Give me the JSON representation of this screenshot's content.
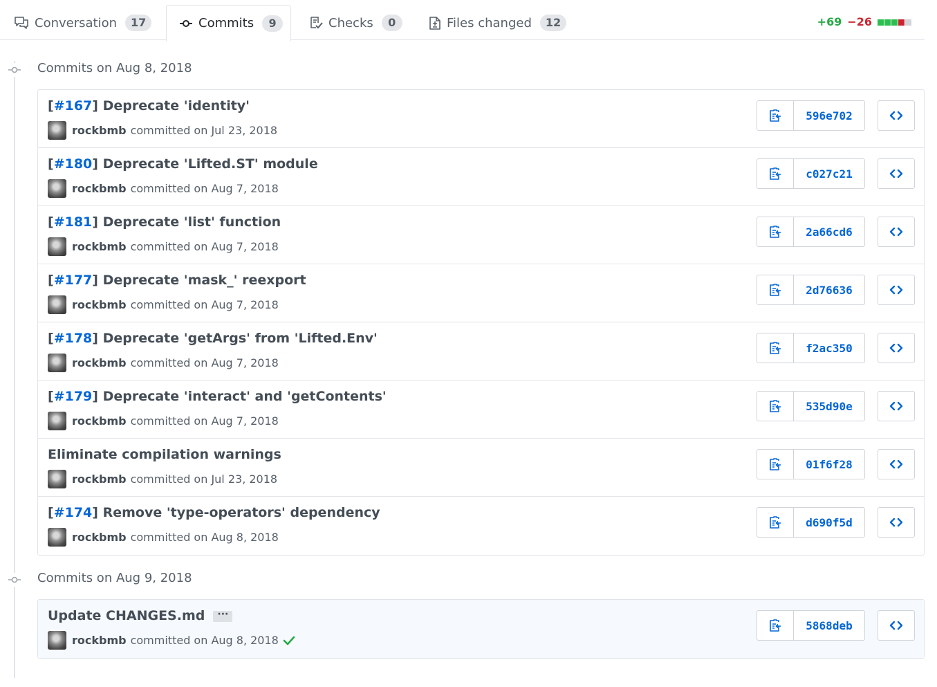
{
  "tabs": {
    "conversation": {
      "label": "Conversation",
      "count": "17",
      "icon": "comment-discussion-icon"
    },
    "commits": {
      "label": "Commits",
      "count": "9",
      "icon": "git-commit-icon"
    },
    "checks": {
      "label": "Checks",
      "count": "0",
      "icon": "checklist-icon"
    },
    "files": {
      "label": "Files changed",
      "count": "12",
      "icon": "file-diff-icon"
    }
  },
  "diffstat": {
    "additions": "+69",
    "deletions": "−26",
    "blocks": [
      "added",
      "added",
      "added",
      "removed",
      "neutral"
    ],
    "colors": {
      "added": "#2cbe4e",
      "removed": "#cb2431",
      "neutral": "#d1d5da"
    }
  },
  "groups": [
    {
      "title": "Commits on Aug 8, 2018",
      "commits": [
        {
          "issue_prefix": "[",
          "issue": "#167",
          "issue_suffix": "]",
          "message": " Deprecate 'identity'",
          "author": "rockbmb",
          "date_text": "committed on Jul 23, 2018",
          "sha": "596e702"
        },
        {
          "issue_prefix": "[",
          "issue": "#180",
          "issue_suffix": "]",
          "message": " Deprecate 'Lifted.ST' module",
          "author": "rockbmb",
          "date_text": "committed on Aug 7, 2018",
          "sha": "c027c21"
        },
        {
          "issue_prefix": "[",
          "issue": "#181",
          "issue_suffix": "]",
          "message": " Deprecate 'list' function",
          "author": "rockbmb",
          "date_text": "committed on Aug 7, 2018",
          "sha": "2a66cd6"
        },
        {
          "issue_prefix": "[",
          "issue": "#177",
          "issue_suffix": "]",
          "message": " Deprecate 'mask_' reexport",
          "author": "rockbmb",
          "date_text": "committed on Aug 7, 2018",
          "sha": "2d76636"
        },
        {
          "issue_prefix": "[",
          "issue": "#178",
          "issue_suffix": "]",
          "message": " Deprecate 'getArgs' from 'Lifted.Env'",
          "author": "rockbmb",
          "date_text": "committed on Aug 7, 2018",
          "sha": "f2ac350"
        },
        {
          "issue_prefix": "[",
          "issue": "#179",
          "issue_suffix": "]",
          "message": " Deprecate 'interact' and 'getContents'",
          "author": "rockbmb",
          "date_text": "committed on Aug 7, 2018",
          "sha": "535d90e"
        },
        {
          "issue_prefix": "",
          "issue": "",
          "issue_suffix": "",
          "message": "Eliminate compilation warnings",
          "author": "rockbmb",
          "date_text": "committed on Jul 23, 2018",
          "sha": "01f6f28"
        },
        {
          "issue_prefix": "[",
          "issue": "#174",
          "issue_suffix": "]",
          "message": " Remove 'type-operators' dependency",
          "author": "rockbmb",
          "date_text": "committed on Aug 8, 2018",
          "sha": "d690f5d"
        }
      ]
    },
    {
      "title": "Commits on Aug 9, 2018",
      "commits": [
        {
          "issue_prefix": "",
          "issue": "",
          "issue_suffix": "",
          "message": "Update CHANGES.md",
          "ellipsis": "···",
          "author": "rockbmb",
          "date_text": "committed on Aug 8, 2018",
          "sha": "5868deb",
          "status": "success"
        }
      ]
    }
  ],
  "colors": {
    "link": "#0366d6",
    "success": "#28a745"
  }
}
